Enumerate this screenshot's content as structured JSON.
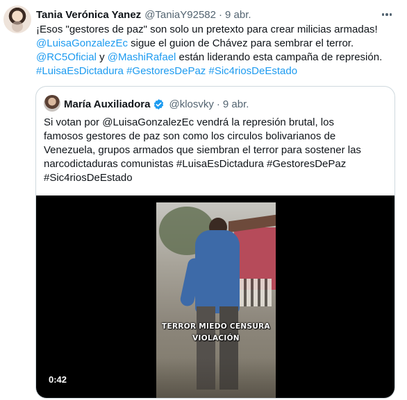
{
  "tweet": {
    "author_name": "Tania Verónica Yanez",
    "author_handle": "@TaniaY92582",
    "separator": "·",
    "date": "9 abr.",
    "more_icon": "more-horizontal-icon",
    "lines": [
      [
        {
          "t": "¡Esos \"gestores de paz\" son solo un pretexto para crear milicias armadas!",
          "link": false
        }
      ],
      [
        {
          "t": "@LuisaGonzalezEc",
          "link": true
        },
        {
          "t": " sigue el guion de Chávez para sembrar el terror.",
          "link": false
        }
      ],
      [
        {
          "t": "@RC5Oficial",
          "link": true
        },
        {
          "t": " y ",
          "link": false
        },
        {
          "t": "@MashiRafael",
          "link": true
        },
        {
          "t": " están liderando esta campaña de represión.",
          "link": false
        }
      ],
      [
        {
          "t": "#LuisaEsDictadura",
          "link": true
        },
        {
          "t": " ",
          "link": false
        },
        {
          "t": "#GestoresDePaz",
          "link": true
        },
        {
          "t": " ",
          "link": false
        },
        {
          "t": "#Sic4riosDeEstado",
          "link": true
        }
      ]
    ]
  },
  "quote": {
    "author_name": "María Auxiliadora",
    "verified_icon": "verified-badge-icon",
    "author_handle": "@klosvky",
    "separator": "·",
    "date": "9 abr.",
    "lines": [
      "Si votan por @LuisaGonzalezEc vendrá la represión brutal, los",
      "famosos gestores de paz son como los circulos bolivarianos de",
      "Venezuela, grupos armados que siembran el terror para sostener las",
      "narcodictaduras comunistas #LuisaEsDictadura #GestoresDePaz",
      "#Sic4riosDeEstado"
    ],
    "video": {
      "caption_line1": "TERROR MIEDO CENSURA",
      "caption_line2": "VIOLACIÓN",
      "duration": "0:42"
    }
  },
  "colors": {
    "link": "#1d9bf0",
    "muted": "#536471",
    "text": "#0f1419",
    "border": "#cfd9de"
  }
}
